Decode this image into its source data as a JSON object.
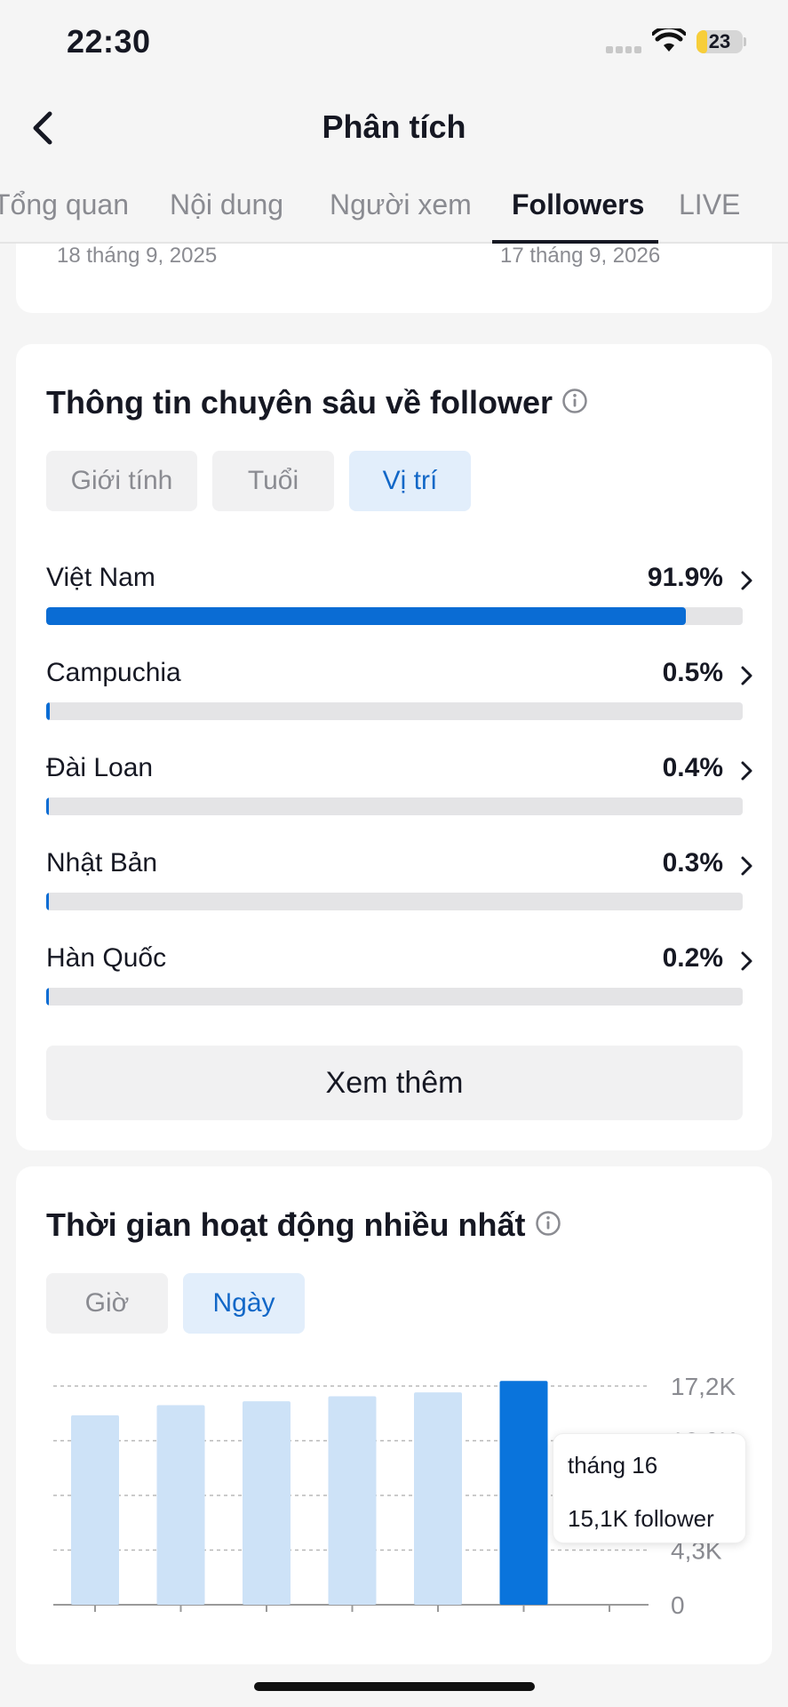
{
  "status_bar": {
    "time": "22:30",
    "battery": "23",
    "battery_level": 0.23
  },
  "nav": {
    "title": "Phân tích"
  },
  "tabs": [
    {
      "label": "Tổng quan"
    },
    {
      "label": "Nội dung"
    },
    {
      "label": "Người xem"
    },
    {
      "label": "Followers",
      "active": true
    },
    {
      "label": "LIVE"
    }
  ],
  "date_range": {
    "start": "18 tháng 9, 2025",
    "end": "17 tháng 9, 2026"
  },
  "insight": {
    "title": "Thông tin chuyên sâu về follower",
    "chips": [
      {
        "label": "Giới tính"
      },
      {
        "label": "Tuổi"
      },
      {
        "label": "Vị trí",
        "active": true
      }
    ],
    "locations": [
      {
        "name": "Việt Nam",
        "percent_label": "91.9%",
        "value": 91.9
      },
      {
        "name": "Campuchia",
        "percent_label": "0.5%",
        "value": 0.5
      },
      {
        "name": "Đài Loan",
        "percent_label": "0.4%",
        "value": 0.4
      },
      {
        "name": "Nhật Bản",
        "percent_label": "0.3%",
        "value": 0.3
      },
      {
        "name": "Hàn Quốc",
        "percent_label": "0.2%",
        "value": 0.2
      }
    ],
    "more_button": "Xem thêm"
  },
  "activity": {
    "title": "Thời gian hoạt động nhiều nhất",
    "chips": [
      {
        "label": "Giờ"
      },
      {
        "label": "Ngày",
        "active": true
      }
    ],
    "tooltip": {
      "label": "tháng 16",
      "value": "15,1K follower"
    }
  },
  "colors": {
    "accent": "#0a6cd4",
    "bar_light": "#cde2f7",
    "bar_highlight": "#0a74dc"
  },
  "chart_data": {
    "type": "bar",
    "categories": [
      "",
      "",
      "",
      "",
      "",
      "",
      ""
    ],
    "values": [
      14.9,
      15.7,
      16.0,
      16.4,
      16.7,
      17.6,
      null
    ],
    "highlight_index": 5,
    "y_ticks": [
      "17,2K",
      "12,9K",
      "4,3K",
      "0"
    ],
    "y_tick_values": [
      17.2,
      12.9,
      8.6,
      4.3,
      0
    ],
    "ylim": [
      0,
      17.2
    ],
    "grid": true,
    "xlabel": "",
    "ylabel": ""
  }
}
